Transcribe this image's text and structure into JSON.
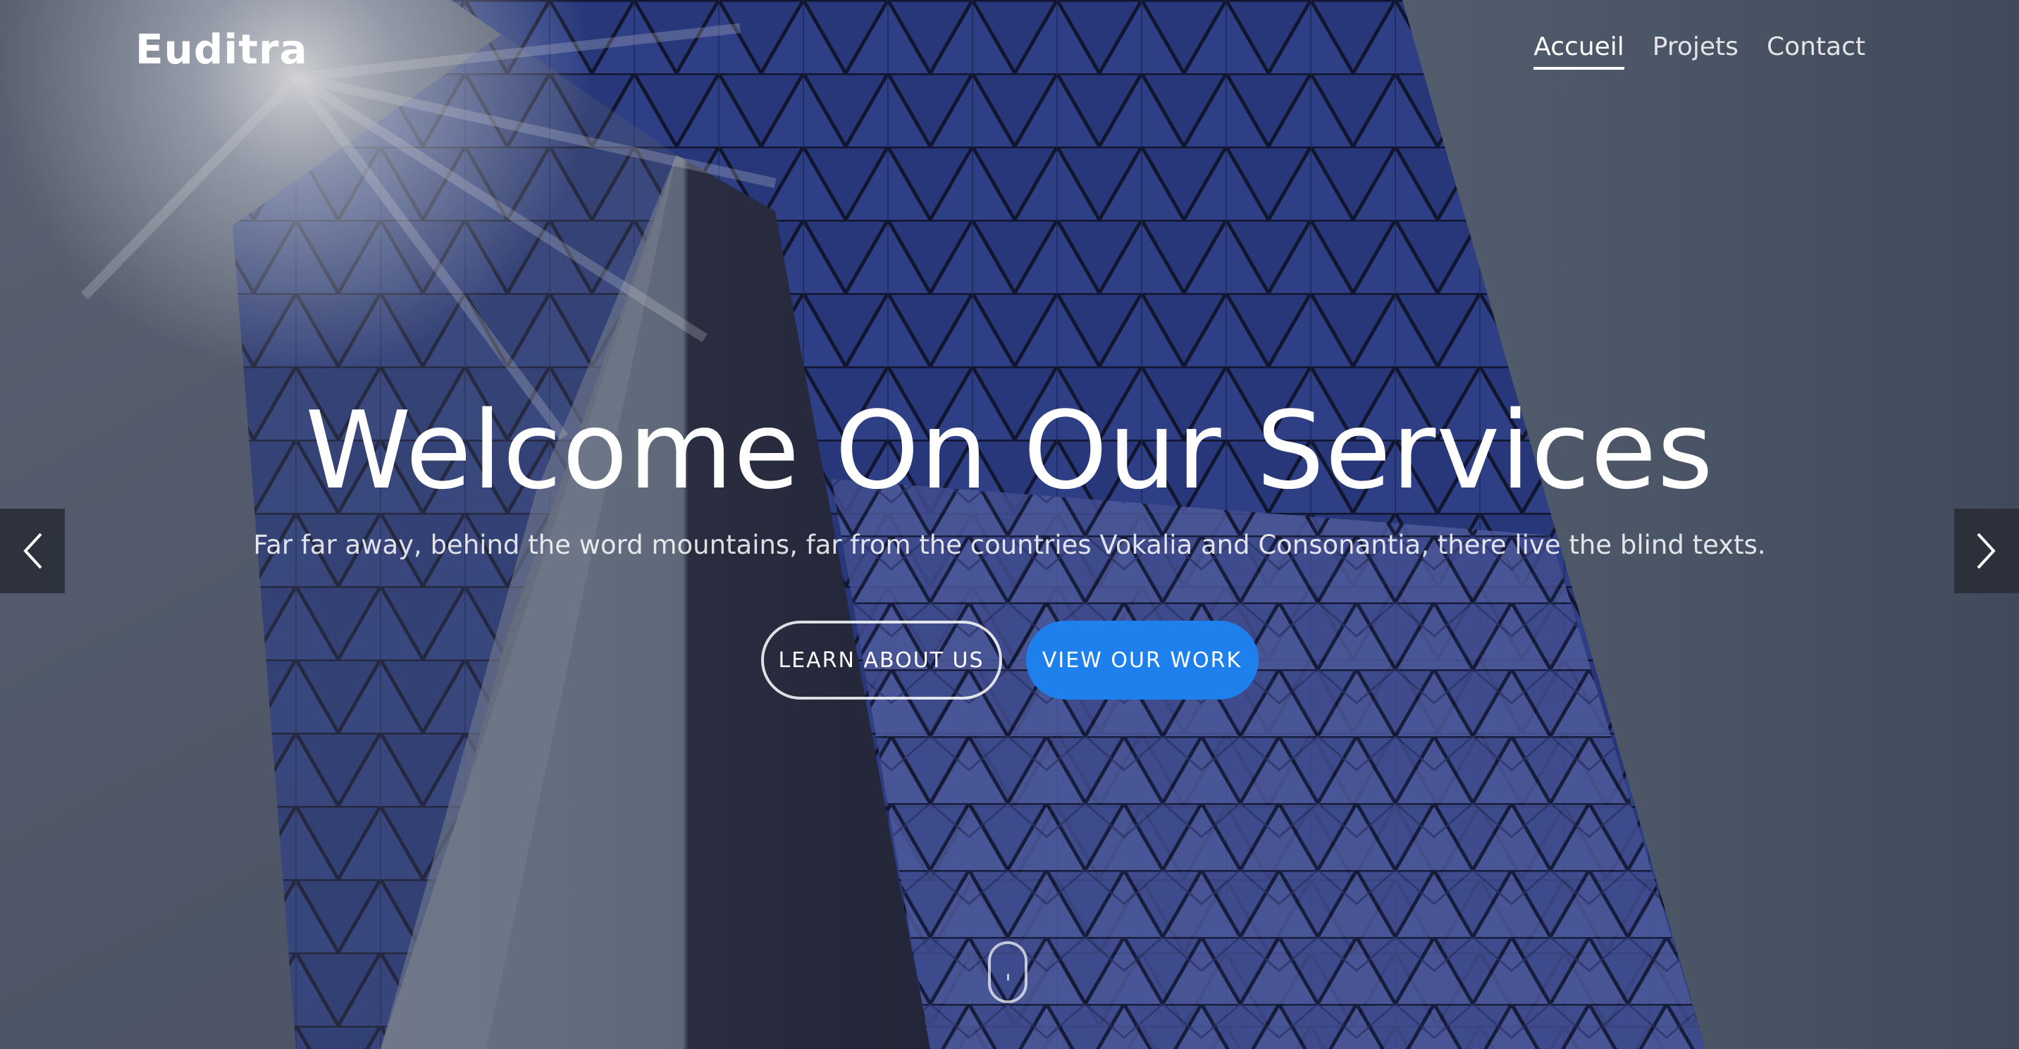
{
  "brand": {
    "name": "Euditra"
  },
  "nav": {
    "items": [
      {
        "label": "Accueil",
        "active": true
      },
      {
        "label": "Projets",
        "active": false
      },
      {
        "label": "Contact",
        "active": false
      }
    ]
  },
  "hero": {
    "title": "Welcome On Our Services",
    "subtitle": "Far far away, behind the word mountains, far from the countries Vokalia and Consonantia, there live the blind texts.",
    "primary_button": "VIEW OUR WORK",
    "secondary_button": "LEARN ABOUT US"
  },
  "icons": {
    "prev": "chevron-left-icon",
    "next": "chevron-right-icon",
    "scroll": "mouse-scroll-icon"
  },
  "colors": {
    "accent": "#1e80ec",
    "text": "#ffffff",
    "arrow_bg": "#282c34"
  }
}
